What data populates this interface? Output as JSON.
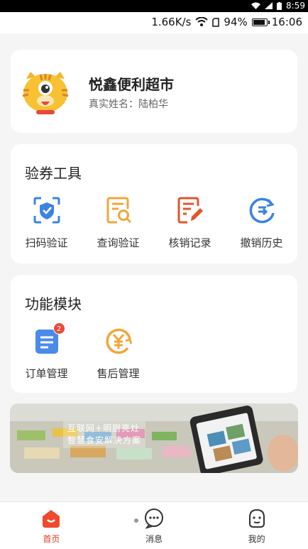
{
  "system": {
    "time_top": "8:59",
    "speed": "1.66K/s",
    "battery": "94%",
    "time": "16:06",
    "battery_level": 0.94
  },
  "profile": {
    "shop_name": "悦鑫便利超市",
    "real_name": "真实姓名：陆柏华"
  },
  "tools": {
    "title": "验券工具",
    "items": [
      {
        "label": "扫码验证",
        "icon": "scan-shield-icon",
        "color": "#3b82e6"
      },
      {
        "label": "查询验证",
        "icon": "search-document-icon",
        "color": "#f0a73b"
      },
      {
        "label": "核销记录",
        "icon": "edit-record-icon",
        "color": "#e2552b"
      },
      {
        "label": "撤销历史",
        "icon": "revoke-history-icon",
        "color": "#3b82e6"
      }
    ]
  },
  "modules": {
    "title": "功能模块",
    "items": [
      {
        "label": "订单管理",
        "icon": "order-list-icon",
        "badge": "2",
        "color": "#3b82e6"
      },
      {
        "label": "售后管理",
        "icon": "after-sale-yen-icon",
        "color": "#f0a73b"
      }
    ]
  },
  "banner": {
    "line1": "互联网+明厨亮灶",
    "line2": "智慧食安解决方案"
  },
  "tabbar": {
    "items": [
      {
        "label": "首页"
      },
      {
        "label": "消息"
      },
      {
        "label": "我的"
      }
    ]
  }
}
